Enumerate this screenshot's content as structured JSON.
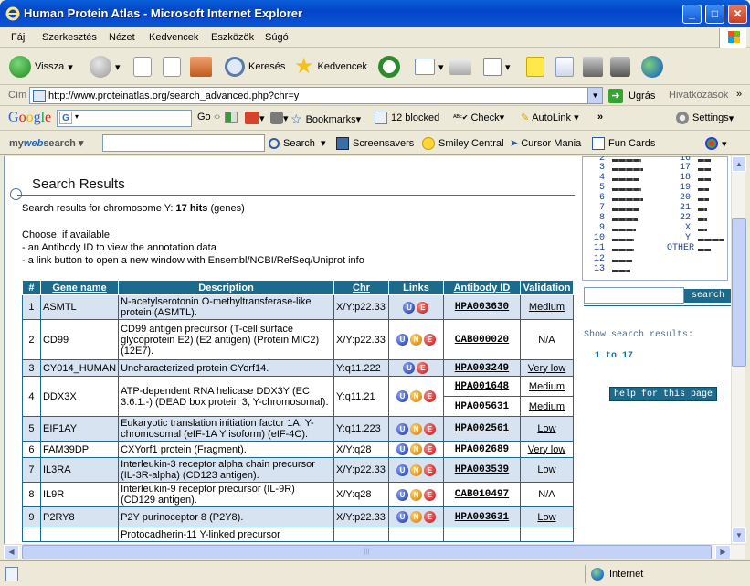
{
  "window": {
    "title": "Human Protein Atlas - Microsoft Internet Explorer",
    "minimize": "_",
    "maximize": "□",
    "close": "✕"
  },
  "menu": [
    "Fájl",
    "Szerkesztés",
    "Nézet",
    "Kedvencek",
    "Eszközök",
    "Súgó"
  ],
  "toolbar": {
    "back": "Vissza",
    "search": "Keresés",
    "favorites": "Kedvencek"
  },
  "address": {
    "label": "Cím",
    "url": "http://www.proteinatlas.org/search_advanced.php?chr=y",
    "go": "Ugrás",
    "links": "Hivatkozások"
  },
  "google": {
    "logo": "Google",
    "go": "Go",
    "bookmarks": "Bookmarks",
    "blocked": "12 blocked",
    "check": "Check",
    "autolink": "AutoLink",
    "more": "»",
    "settings": "Settings"
  },
  "mywebsearch": {
    "logo": "mywebsearch",
    "search": "Search",
    "screensavers": "Screensavers",
    "smiley": "Smiley Central",
    "cursor": "Cursor Mania",
    "funcards": "Fun Cards"
  },
  "page": {
    "title": "Search Results",
    "summary_prefix": "Search results for chromosome Y: ",
    "summary_hits": "17 hits",
    "summary_suffix": " (genes)",
    "choose": "Choose, if available:",
    "choose_line1": "- an Antibody ID to view the annotation data",
    "choose_line2": "- a link button to open a new window with Ensembl/NCBI/RefSeq/Uniprot info",
    "headers": {
      "gene": "Gene name",
      "desc": "Description",
      "chr": "Chr",
      "links": "Links",
      "antibody": "Antibody ID",
      "validation": "Validation"
    },
    "rows": [
      {
        "n": "1",
        "gene": "ASMTL",
        "desc": "N-acetylserotonin O-methyltransferase-like protein (ASMTL).",
        "chr": "X/Y:p22.33",
        "links": [
          "U",
          "E"
        ],
        "antibodies": [
          {
            "id": "HPA003630",
            "val": "Medium"
          }
        ]
      },
      {
        "n": "2",
        "gene": "CD99",
        "desc": "CD99 antigen precursor (T-cell surface glycoprotein E2) (E2 antigen) (Protein MIC2) (12E7).",
        "chr": "X/Y:p22.33",
        "links": [
          "U",
          "N",
          "E"
        ],
        "antibodies": [
          {
            "id": "CAB000020",
            "val": "N/A"
          }
        ]
      },
      {
        "n": "3",
        "gene": "CY014_HUMAN",
        "desc": "Uncharacterized protein CYorf14.",
        "chr": "Y:q11.222",
        "links": [
          "U",
          "E"
        ],
        "antibodies": [
          {
            "id": "HPA003249",
            "val": "Very low"
          }
        ]
      },
      {
        "n": "4",
        "gene": "DDX3X",
        "desc": "ATP-dependent RNA helicase DDX3Y (EC 3.6.1.-) (DEAD box protein 3, Y-chromosomal).",
        "chr": "Y:q11.21",
        "links": [
          "U",
          "N",
          "E"
        ],
        "antibodies": [
          {
            "id": "HPA001648",
            "val": "Medium"
          },
          {
            "id": "HPA005631",
            "val": "Medium"
          }
        ]
      },
      {
        "n": "5",
        "gene": "EIF1AY",
        "desc": "Eukaryotic translation initiation factor 1A, Y-chromosomal (eIF-1A Y isoform) (eIF-4C).",
        "chr": "Y:q11.223",
        "links": [
          "U",
          "N",
          "E"
        ],
        "antibodies": [
          {
            "id": "HPA002561",
            "val": "Low"
          }
        ]
      },
      {
        "n": "6",
        "gene": "FAM39DP",
        "desc": "CXYorf1 protein (Fragment).",
        "chr": "X/Y:q28",
        "links": [
          "U",
          "N",
          "E"
        ],
        "antibodies": [
          {
            "id": "HPA002689",
            "val": "Very low"
          }
        ]
      },
      {
        "n": "7",
        "gene": "IL3RA",
        "desc": "Interleukin-3 receptor alpha chain precursor (IL-3R-alpha) (CD123 antigen).",
        "chr": "X/Y:p22.33",
        "links": [
          "U",
          "N",
          "E"
        ],
        "antibodies": [
          {
            "id": "HPA003539",
            "val": "Low"
          }
        ]
      },
      {
        "n": "8",
        "gene": "IL9R",
        "desc": "Interleukin-9 receptor precursor (IL-9R) (CD129 antigen).",
        "chr": "X/Y:q28",
        "links": [
          "U",
          "N",
          "E"
        ],
        "antibodies": [
          {
            "id": "CAB010497",
            "val": "N/A"
          }
        ]
      },
      {
        "n": "9",
        "gene": "P2RY8",
        "desc": "P2Y purinoceptor 8 (P2Y8).",
        "chr": "X/Y:p22.33",
        "links": [
          "U",
          "N",
          "E"
        ],
        "antibodies": [
          {
            "id": "HPA003631",
            "val": "Low"
          }
        ]
      },
      {
        "n": "",
        "gene": "",
        "desc": "Protocadherin-11 Y-linked precursor",
        "chr": "",
        "links": [],
        "antibodies": [
          {
            "id": "",
            "val": ""
          }
        ]
      }
    ]
  },
  "sidebar": {
    "chromosomes_left": [
      "2",
      "3",
      "4",
      "5",
      "6",
      "7",
      "8",
      "9",
      "10",
      "11",
      "12",
      "13"
    ],
    "chromosomes_right": [
      "16",
      "17",
      "18",
      "19",
      "20",
      "21",
      "22",
      "X",
      "Y",
      "OTHER"
    ],
    "search_button": "search",
    "show_label": "Show search results:",
    "range": "1 to 17",
    "help": "help for this page"
  },
  "status": {
    "zone": "Internet"
  }
}
